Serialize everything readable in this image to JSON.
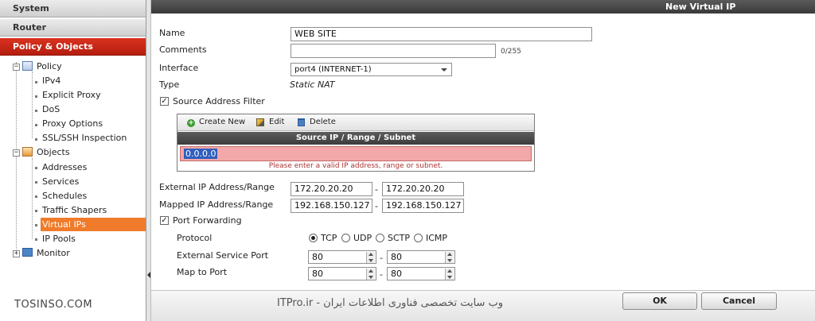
{
  "nav": {
    "headers": [
      "System",
      "Router",
      "Policy & Objects"
    ],
    "tree": {
      "policy": "Policy",
      "policy_items": [
        "IPv4",
        "Explicit Proxy",
        "DoS",
        "Proxy Options",
        "SSL/SSH Inspection"
      ],
      "objects": "Objects",
      "objects_items": [
        "Addresses",
        "Services",
        "Schedules",
        "Traffic Shapers",
        "Virtual IPs",
        "IP Pools"
      ],
      "monitor": "Monitor",
      "selected": "Virtual IPs"
    }
  },
  "dialog": {
    "title": "New Virtual IP",
    "name_label": "Name",
    "name_value": "WEB SITE",
    "comments_label": "Comments",
    "comments_counter": "0/255",
    "interface_label": "Interface",
    "interface_value": "port4 (INTERNET-1)",
    "type_label": "Type",
    "type_value": "Static NAT",
    "source_filter_label": "Source Address Filter",
    "source_filter_checked": true,
    "toolbar": {
      "create": "Create New",
      "edit": "Edit",
      "delete": "Delete"
    },
    "grid_header": "Source IP / Range / Subnet",
    "grid_value": "0.0.0.0",
    "grid_error": "Please enter a valid IP address, range or subnet.",
    "external_label": "External IP Address/Range",
    "external_start": "172.20.20.20",
    "external_end": "172.20.20.20",
    "mapped_label": "Mapped IP Address/Range",
    "mapped_start": "192.168.150.127",
    "mapped_end": "192.168.150.127",
    "range_sep": "-",
    "port_forwarding_label": "Port Forwarding",
    "port_forwarding_checked": true,
    "protocol_label": "Protocol",
    "protocols": [
      "TCP",
      "UDP",
      "SCTP",
      "ICMP"
    ],
    "protocol_selected": "TCP",
    "ext_port_label": "External Service Port",
    "ext_port_start": "80",
    "ext_port_end": "80",
    "map_port_label": "Map to Port",
    "map_port_start": "80",
    "map_port_end": "80",
    "ok_label": "OK",
    "cancel_label": "Cancel"
  },
  "watermarks": {
    "left": "TOSINSO.COM",
    "center": "ITPro.ir - وب سایت تخصصی فناوری اطلاعات ایران"
  },
  "colors": {
    "active_header": "#c8281a",
    "selected_item": "#f07b2b",
    "error_row": "#f2a8a8"
  }
}
